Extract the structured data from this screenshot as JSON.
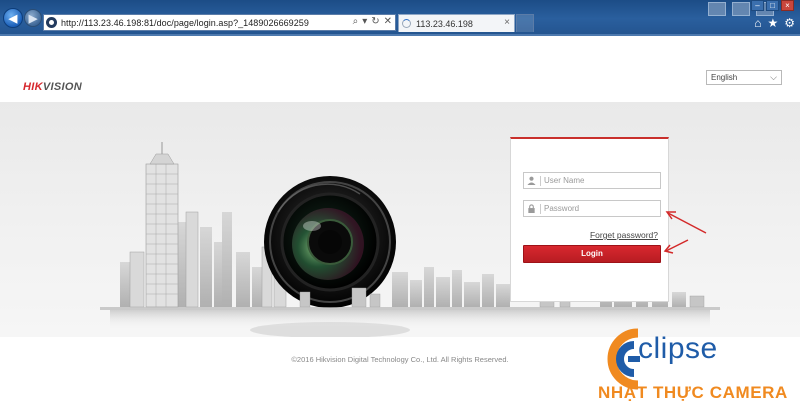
{
  "browser": {
    "url": "http://113.23.46.198:81/doc/page/login.asp?_1489026669259",
    "tab_title": "113.23.46.198",
    "tab_close": "×",
    "back_icon": "arrow-left-icon",
    "forward_icon": "arrow-right-icon",
    "addr_search": "⌕",
    "addr_dropdown": "▾",
    "addr_refresh": "↻",
    "addr_close": "✕",
    "home_icon": "⌂",
    "favorites_icon": "★",
    "tools_icon": "⚙"
  },
  "header": {
    "logo_hik": "HIK",
    "logo_vision": "VISION",
    "language": "English",
    "language_arrow": "⌵"
  },
  "login": {
    "username_placeholder": "User Name",
    "password_placeholder": "Password",
    "forgot_password": "Forget password?",
    "login_button": "Login"
  },
  "footer": {
    "copyright": "©2016 Hikvision Digital Technology Co., Ltd. All Rights Reserved."
  },
  "watermark": {
    "brand": "clipse",
    "subtitle": "NHẬT THỰC CAMERA"
  },
  "colors": {
    "accent_red": "#d6272d",
    "chrome_blue": "#2a5f9e",
    "watermark_blue": "#1f5ca8",
    "watermark_orange": "#f08a20"
  }
}
